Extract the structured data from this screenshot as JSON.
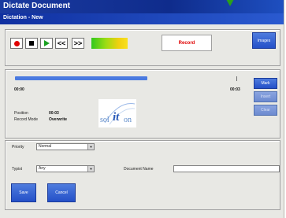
{
  "window": {
    "title": "Dictate Document",
    "subtitle": "Dictation - New"
  },
  "toolbar": {
    "record_icon": "record-icon",
    "stop_icon": "stop-icon",
    "play_icon": "play-icon",
    "rewind_label": "<<",
    "forward_label": ">>",
    "level_colors": [
      "#32c81e",
      "#f0d010"
    ]
  },
  "buttons": {
    "record": "Record",
    "images": "Images",
    "mark": "Mark",
    "insert": "Insert",
    "clear": "Clear",
    "save": "Save",
    "cancel": "Cancel"
  },
  "playback": {
    "start_time": "00:00",
    "end_time": "00:03",
    "position_label": "Position",
    "position_value": "00:03",
    "record_mode_label": "Record Mode",
    "record_mode_value": "Overwrite",
    "progress_fraction": 1.0
  },
  "logo": {
    "text_left": "sol",
    "text_mid": "it",
    "text_right": "on"
  },
  "form": {
    "priority_label": "Priority",
    "priority_value": "Normal",
    "typist_label": "Typist",
    "typist_value": "Any",
    "document_name_label": "Document Name",
    "document_name_value": ""
  }
}
